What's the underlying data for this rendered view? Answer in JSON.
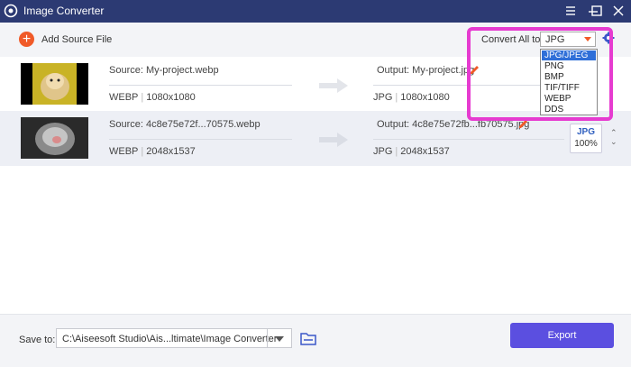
{
  "window": {
    "title": "Image Converter"
  },
  "toolbar": {
    "add_label": "Add Source File",
    "convert_all_label": "Convert All to:",
    "selected_format": "JPG",
    "format_options": [
      "JPG/JPEG",
      "PNG",
      "BMP",
      "TIF/TIFF",
      "WEBP",
      "DDS"
    ],
    "highlighted_option": "JPG/JPEG"
  },
  "files": [
    {
      "source": "Source: My-project.webp",
      "src_format": "WEBP",
      "src_dims": "1080x1080",
      "output": "Output: My-project.jpg",
      "out_format": "JPG",
      "out_dims": "1080x1080"
    },
    {
      "source": "Source: 4c8e75e72f...70575.webp",
      "src_format": "WEBP",
      "src_dims": "2048x1537",
      "output": "Output: 4c8e75e72fb...fb70575.jpg",
      "out_format": "JPG",
      "out_dims": "2048x1537",
      "badge_format": "JPG",
      "badge_quality": "100%"
    }
  ],
  "footer": {
    "save_to_label": "Save to:",
    "save_path": "C:\\Aiseesoft Studio\\Ais...ltimate\\Image Converter",
    "export_label": "Export"
  },
  "colors": {
    "titlebar": "#2c3a73",
    "accent": "#5b4fe0",
    "highlight": "#e63bd0",
    "add": "#f05a28"
  }
}
